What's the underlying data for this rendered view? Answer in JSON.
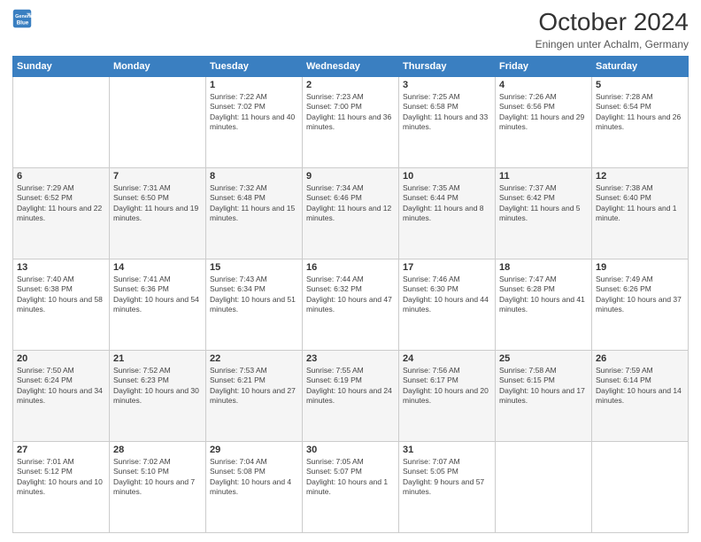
{
  "header": {
    "logo_line1": "General",
    "logo_line2": "Blue",
    "month": "October 2024",
    "location": "Eningen unter Achalm, Germany"
  },
  "days_of_week": [
    "Sunday",
    "Monday",
    "Tuesday",
    "Wednesday",
    "Thursday",
    "Friday",
    "Saturday"
  ],
  "weeks": [
    [
      {
        "day": "",
        "sunrise": "",
        "sunset": "",
        "daylight": ""
      },
      {
        "day": "",
        "sunrise": "",
        "sunset": "",
        "daylight": ""
      },
      {
        "day": "1",
        "sunrise": "Sunrise: 7:22 AM",
        "sunset": "Sunset: 7:02 PM",
        "daylight": "Daylight: 11 hours and 40 minutes."
      },
      {
        "day": "2",
        "sunrise": "Sunrise: 7:23 AM",
        "sunset": "Sunset: 7:00 PM",
        "daylight": "Daylight: 11 hours and 36 minutes."
      },
      {
        "day": "3",
        "sunrise": "Sunrise: 7:25 AM",
        "sunset": "Sunset: 6:58 PM",
        "daylight": "Daylight: 11 hours and 33 minutes."
      },
      {
        "day": "4",
        "sunrise": "Sunrise: 7:26 AM",
        "sunset": "Sunset: 6:56 PM",
        "daylight": "Daylight: 11 hours and 29 minutes."
      },
      {
        "day": "5",
        "sunrise": "Sunrise: 7:28 AM",
        "sunset": "Sunset: 6:54 PM",
        "daylight": "Daylight: 11 hours and 26 minutes."
      }
    ],
    [
      {
        "day": "6",
        "sunrise": "Sunrise: 7:29 AM",
        "sunset": "Sunset: 6:52 PM",
        "daylight": "Daylight: 11 hours and 22 minutes."
      },
      {
        "day": "7",
        "sunrise": "Sunrise: 7:31 AM",
        "sunset": "Sunset: 6:50 PM",
        "daylight": "Daylight: 11 hours and 19 minutes."
      },
      {
        "day": "8",
        "sunrise": "Sunrise: 7:32 AM",
        "sunset": "Sunset: 6:48 PM",
        "daylight": "Daylight: 11 hours and 15 minutes."
      },
      {
        "day": "9",
        "sunrise": "Sunrise: 7:34 AM",
        "sunset": "Sunset: 6:46 PM",
        "daylight": "Daylight: 11 hours and 12 minutes."
      },
      {
        "day": "10",
        "sunrise": "Sunrise: 7:35 AM",
        "sunset": "Sunset: 6:44 PM",
        "daylight": "Daylight: 11 hours and 8 minutes."
      },
      {
        "day": "11",
        "sunrise": "Sunrise: 7:37 AM",
        "sunset": "Sunset: 6:42 PM",
        "daylight": "Daylight: 11 hours and 5 minutes."
      },
      {
        "day": "12",
        "sunrise": "Sunrise: 7:38 AM",
        "sunset": "Sunset: 6:40 PM",
        "daylight": "Daylight: 11 hours and 1 minute."
      }
    ],
    [
      {
        "day": "13",
        "sunrise": "Sunrise: 7:40 AM",
        "sunset": "Sunset: 6:38 PM",
        "daylight": "Daylight: 10 hours and 58 minutes."
      },
      {
        "day": "14",
        "sunrise": "Sunrise: 7:41 AM",
        "sunset": "Sunset: 6:36 PM",
        "daylight": "Daylight: 10 hours and 54 minutes."
      },
      {
        "day": "15",
        "sunrise": "Sunrise: 7:43 AM",
        "sunset": "Sunset: 6:34 PM",
        "daylight": "Daylight: 10 hours and 51 minutes."
      },
      {
        "day": "16",
        "sunrise": "Sunrise: 7:44 AM",
        "sunset": "Sunset: 6:32 PM",
        "daylight": "Daylight: 10 hours and 47 minutes."
      },
      {
        "day": "17",
        "sunrise": "Sunrise: 7:46 AM",
        "sunset": "Sunset: 6:30 PM",
        "daylight": "Daylight: 10 hours and 44 minutes."
      },
      {
        "day": "18",
        "sunrise": "Sunrise: 7:47 AM",
        "sunset": "Sunset: 6:28 PM",
        "daylight": "Daylight: 10 hours and 41 minutes."
      },
      {
        "day": "19",
        "sunrise": "Sunrise: 7:49 AM",
        "sunset": "Sunset: 6:26 PM",
        "daylight": "Daylight: 10 hours and 37 minutes."
      }
    ],
    [
      {
        "day": "20",
        "sunrise": "Sunrise: 7:50 AM",
        "sunset": "Sunset: 6:24 PM",
        "daylight": "Daylight: 10 hours and 34 minutes."
      },
      {
        "day": "21",
        "sunrise": "Sunrise: 7:52 AM",
        "sunset": "Sunset: 6:23 PM",
        "daylight": "Daylight: 10 hours and 30 minutes."
      },
      {
        "day": "22",
        "sunrise": "Sunrise: 7:53 AM",
        "sunset": "Sunset: 6:21 PM",
        "daylight": "Daylight: 10 hours and 27 minutes."
      },
      {
        "day": "23",
        "sunrise": "Sunrise: 7:55 AM",
        "sunset": "Sunset: 6:19 PM",
        "daylight": "Daylight: 10 hours and 24 minutes."
      },
      {
        "day": "24",
        "sunrise": "Sunrise: 7:56 AM",
        "sunset": "Sunset: 6:17 PM",
        "daylight": "Daylight: 10 hours and 20 minutes."
      },
      {
        "day": "25",
        "sunrise": "Sunrise: 7:58 AM",
        "sunset": "Sunset: 6:15 PM",
        "daylight": "Daylight: 10 hours and 17 minutes."
      },
      {
        "day": "26",
        "sunrise": "Sunrise: 7:59 AM",
        "sunset": "Sunset: 6:14 PM",
        "daylight": "Daylight: 10 hours and 14 minutes."
      }
    ],
    [
      {
        "day": "27",
        "sunrise": "Sunrise: 7:01 AM",
        "sunset": "Sunset: 5:12 PM",
        "daylight": "Daylight: 10 hours and 10 minutes."
      },
      {
        "day": "28",
        "sunrise": "Sunrise: 7:02 AM",
        "sunset": "Sunset: 5:10 PM",
        "daylight": "Daylight: 10 hours and 7 minutes."
      },
      {
        "day": "29",
        "sunrise": "Sunrise: 7:04 AM",
        "sunset": "Sunset: 5:08 PM",
        "daylight": "Daylight: 10 hours and 4 minutes."
      },
      {
        "day": "30",
        "sunrise": "Sunrise: 7:05 AM",
        "sunset": "Sunset: 5:07 PM",
        "daylight": "Daylight: 10 hours and 1 minute."
      },
      {
        "day": "31",
        "sunrise": "Sunrise: 7:07 AM",
        "sunset": "Sunset: 5:05 PM",
        "daylight": "Daylight: 9 hours and 57 minutes."
      },
      {
        "day": "",
        "sunrise": "",
        "sunset": "",
        "daylight": ""
      },
      {
        "day": "",
        "sunrise": "",
        "sunset": "",
        "daylight": ""
      }
    ]
  ]
}
